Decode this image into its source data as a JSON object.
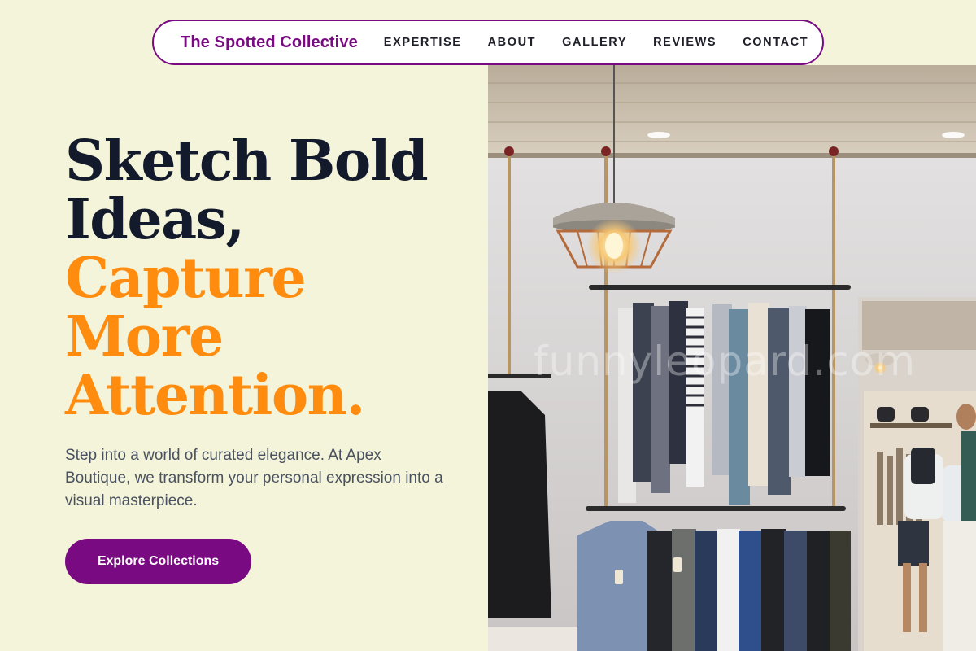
{
  "header": {
    "brand": "The Spotted Collective",
    "nav": [
      {
        "label": "EXPERTISE"
      },
      {
        "label": "ABOUT"
      },
      {
        "label": "GALLERY"
      },
      {
        "label": "REVIEWS"
      },
      {
        "label": "CONTACT"
      }
    ]
  },
  "hero": {
    "headline_dark": [
      "Sketch Bold",
      "Ideas,"
    ],
    "headline_accent": [
      "Capture",
      "More",
      "Attention."
    ],
    "lede": "Step into a world of curated elegance. At Apex Boutique, we transform your personal expression into a visual masterpiece.",
    "cta_label": "Explore Collections"
  },
  "image": {
    "subject": "clothing boutique interior with hanging garments and pendant lamp",
    "watermark": "funnyleopard.com"
  },
  "colors": {
    "background": "#f4f4da",
    "brand_purple": "#7a0a82",
    "accent_orange": "#ff8c0f",
    "heading_dark": "#131a2c",
    "body_text": "#4a5160"
  }
}
